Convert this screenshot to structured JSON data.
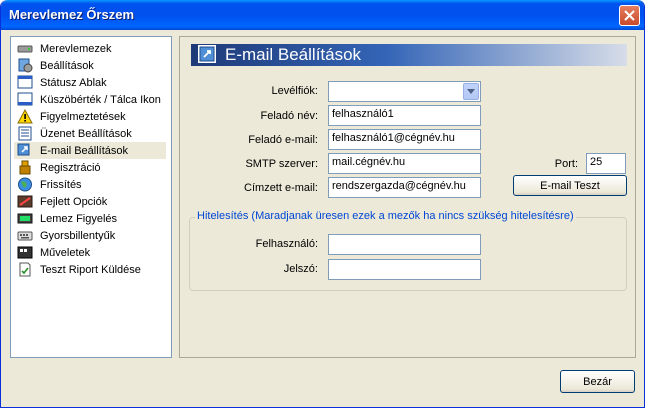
{
  "window": {
    "title": "Merevlemez Őrszem"
  },
  "sidebar": {
    "items": [
      {
        "label": "Merevlemezek",
        "icon": "hard-drive-icon"
      },
      {
        "label": "Beállítások",
        "icon": "settings-icon"
      },
      {
        "label": "Státusz Ablak",
        "icon": "status-window-icon"
      },
      {
        "label": "Küszöbérték / Tálca Ikon",
        "icon": "threshold-tray-icon"
      },
      {
        "label": "Figyelmeztetések",
        "icon": "warning-icon"
      },
      {
        "label": "Üzenet Beállítások",
        "icon": "message-settings-icon"
      },
      {
        "label": "E-mail Beállítások",
        "icon": "email-settings-icon"
      },
      {
        "label": "Regisztráció",
        "icon": "registration-icon"
      },
      {
        "label": "Frissítés",
        "icon": "globe-icon"
      },
      {
        "label": "Fejlett Opciók",
        "icon": "advanced-options-icon"
      },
      {
        "label": "Lemez Figyelés",
        "icon": "disk-monitor-icon"
      },
      {
        "label": "Gyorsbillentyűk",
        "icon": "keyboard-icon"
      },
      {
        "label": "Műveletek",
        "icon": "actions-icon"
      },
      {
        "label": "Teszt Riport Küldése",
        "icon": "report-icon"
      }
    ],
    "selected": "E-mail Beállítások"
  },
  "panel": {
    "title": "E-mail Beállítások",
    "fields": {
      "mail_account": {
        "label": "Levélfiók:",
        "value": ""
      },
      "sender_name": {
        "label": "Feladó név:",
        "value": "felhasználó1"
      },
      "sender_email": {
        "label": "Feladó e-mail:",
        "value": "felhasználó1@cégnév.hu"
      },
      "smtp_server": {
        "label": "SMTP szerver:",
        "value": "mail.cégnév.hu"
      },
      "port": {
        "label": "Port:",
        "value": "25"
      },
      "recipient_email": {
        "label": "Címzett e-mail:",
        "value": "rendszergazda@cégnév.hu"
      }
    },
    "test_button": "E-mail Teszt",
    "auth": {
      "legend": "Hitelesítés (Maradjanak üresen ezek a mezők ha nincs szükség hitelesítésre)",
      "username": {
        "label": "Felhasználó:",
        "value": ""
      },
      "password": {
        "label": "Jelszó:",
        "value": ""
      }
    }
  },
  "footer": {
    "close_button": "Bezár"
  },
  "colors": {
    "titlebar": "#0054e3",
    "selection": "#ece9d8",
    "legend": "#0046d5",
    "header_dark": "#1e3a78"
  }
}
